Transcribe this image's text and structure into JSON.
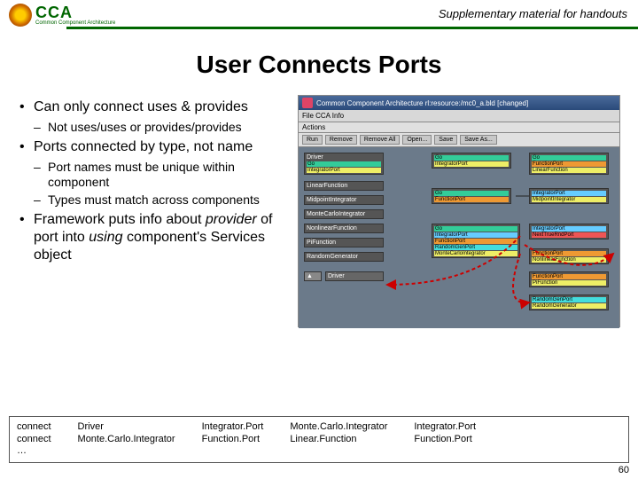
{
  "header": {
    "cca": "CCA",
    "sub": "Common Component Architecture",
    "supp": "Supplementary material for handouts"
  },
  "title": "User Connects Ports",
  "bullets": {
    "b1": "Can only connect uses & provides",
    "b1a": "Not uses/uses or provides/provides",
    "b2": "Ports connected by type, not name",
    "b2a": "Port names must be unique within component",
    "b2b": "Types must match across components",
    "b3_a": "Framework puts info about ",
    "b3_b": "provider",
    "b3_c": " of port into ",
    "b3_d": "using",
    "b3_e": " component's Services object"
  },
  "shot": {
    "title": "Common Component Architecture   rl:resource:/mc0_a.bld   [changed]",
    "menu": "File   CCA Info",
    "sub": "Actions",
    "tools": [
      "Run",
      "Remove",
      "Remove All",
      "Open...",
      "Save",
      "Save As..."
    ],
    "comps": {
      "driver": "Driver",
      "lf": "LinearFunction",
      "mi": "MidpointIntegrator",
      "mci": "MonteCarloIntegrator",
      "nlf": "NonlinearFunction",
      "pf": "PiFunction",
      "rg": "RandomGenerator",
      "go": "Go",
      "fp": "FunctionPort",
      "ip": "IntegratorPort",
      "rp": "RandomGenPort",
      "lf2": "LinearFunction",
      "nt": "NextTrueRndPort",
      "mi2": "MidpointIntegrator",
      "mci2": "MonteCarloIntegrator",
      "nlf2": "NonlinearFunction",
      "pf2": "PiFunction",
      "rg2": "RandomGenerator"
    }
  },
  "code": {
    "c1a": "connect",
    "c1b": "connect",
    "c1c": "…",
    "c2a": "Driver",
    "c2b": "Monte.Carlo.Integrator",
    "c3a": "Integrator.Port",
    "c3b": "Function.Port",
    "c4a": "Monte.Carlo.Integrator",
    "c4b": "Linear.Function",
    "c5a": "Integrator.Port",
    "c5b": "Function.Port"
  },
  "page": "60"
}
